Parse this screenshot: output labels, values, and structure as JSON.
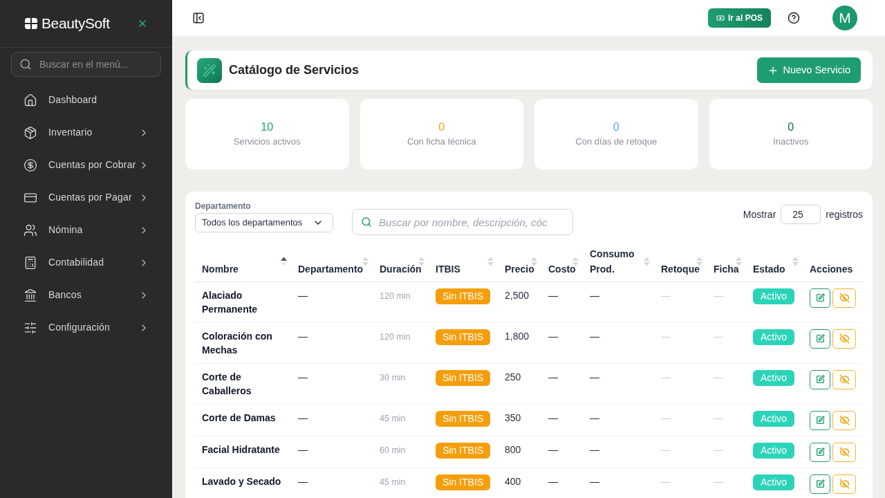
{
  "sidebar": {
    "brand": "BeautySoft",
    "search": {
      "placeholder": "Buscar en el menú..."
    },
    "items": [
      {
        "label": "Dashboard",
        "expandable": false,
        "selected": false
      },
      {
        "label": "Inventario",
        "expandable": true,
        "selected": false
      },
      {
        "label": "Cuentas por Cobrar",
        "expandable": true,
        "selected": false
      },
      {
        "label": "Cuentas por Pagar",
        "expandable": true,
        "selected": false
      },
      {
        "label": "Nómina",
        "expandable": true,
        "selected": false
      },
      {
        "label": "Contabilidad",
        "expandable": true,
        "selected": false
      },
      {
        "label": "Bancos",
        "expandable": true,
        "selected": false
      },
      {
        "label": "Configuración",
        "expandable": true,
        "selected": false
      }
    ]
  },
  "topbar": {
    "pos_button": "Ir al POS",
    "avatar": "M"
  },
  "page": {
    "title": "Catálogo de Servicios",
    "new_button": "Nuevo Servicio"
  },
  "stats": [
    {
      "value": "10",
      "label": "Servicios activos",
      "color": "#16a36f"
    },
    {
      "value": "0",
      "label": "Con ficha técnica",
      "color": "#f5a30b"
    },
    {
      "value": "0",
      "label": "Con días de retoque",
      "color": "#60a5fa"
    },
    {
      "value": "0",
      "label": "Inactivos",
      "color": "#0f6b48"
    }
  ],
  "filters": {
    "department": {
      "label": "Departamento",
      "value": "Todos los departamentos"
    },
    "search": {
      "placeholder": "Buscar por nombre, descripción, cóc"
    },
    "page_size": {
      "prefix": "Mostrar",
      "value": "25",
      "suffix": "registros"
    }
  },
  "table": {
    "columns": [
      {
        "label": "Nombre",
        "kind": "name",
        "sortable": true,
        "sorted": true
      },
      {
        "label": "Departamento",
        "kind": "text",
        "sortable": true,
        "sorted": false
      },
      {
        "label": "Duración",
        "kind": "muted",
        "sortable": true,
        "sorted": false
      },
      {
        "label": "ITBIS",
        "kind": "tag",
        "sortable": true,
        "sorted": false
      },
      {
        "label": "Precio",
        "kind": "text",
        "sortable": true,
        "sorted": false
      },
      {
        "label": "Costo",
        "kind": "text",
        "sortable": true,
        "sorted": false
      },
      {
        "label": "Consumo Prod.",
        "kind": "text",
        "sortable": true,
        "sorted": false
      },
      {
        "label": "Retoque",
        "kind": "faint",
        "sortable": true,
        "sorted": false
      },
      {
        "label": "Ficha",
        "kind": "faint",
        "sortable": true,
        "sorted": false
      },
      {
        "label": "Estado",
        "kind": "status",
        "sortable": true,
        "sorted": false
      },
      {
        "label": "Acciones",
        "kind": "actions",
        "sortable": false,
        "sorted": false
      }
    ],
    "rows": [
      {
        "cells": [
          "Alaciado Permanente",
          "—",
          "120 min",
          "Sin ITBIS",
          "2,500",
          "—",
          "—",
          "—",
          "—",
          "Activo"
        ]
      },
      {
        "cells": [
          "Coloración con Mechas",
          "—",
          "120 min",
          "Sin ITBIS",
          "1,800",
          "—",
          "—",
          "—",
          "—",
          "Activo"
        ]
      },
      {
        "cells": [
          "Corte de Caballeros",
          "—",
          "30 min",
          "Sin ITBIS",
          "250",
          "—",
          "—",
          "—",
          "—",
          "Activo"
        ]
      },
      {
        "cells": [
          "Corte de Damas",
          "—",
          "45 min",
          "Sin ITBIS",
          "350",
          "—",
          "—",
          "—",
          "—",
          "Activo"
        ]
      },
      {
        "cells": [
          "Facial Hidratante",
          "—",
          "60 min",
          "Sin ITBIS",
          "800",
          "—",
          "—",
          "—",
          "—",
          "Activo"
        ]
      },
      {
        "cells": [
          "Lavado y Secado",
          "—",
          "45 min",
          "Sin ITBIS",
          "400",
          "—",
          "—",
          "—",
          "—",
          "Activo"
        ]
      }
    ]
  }
}
